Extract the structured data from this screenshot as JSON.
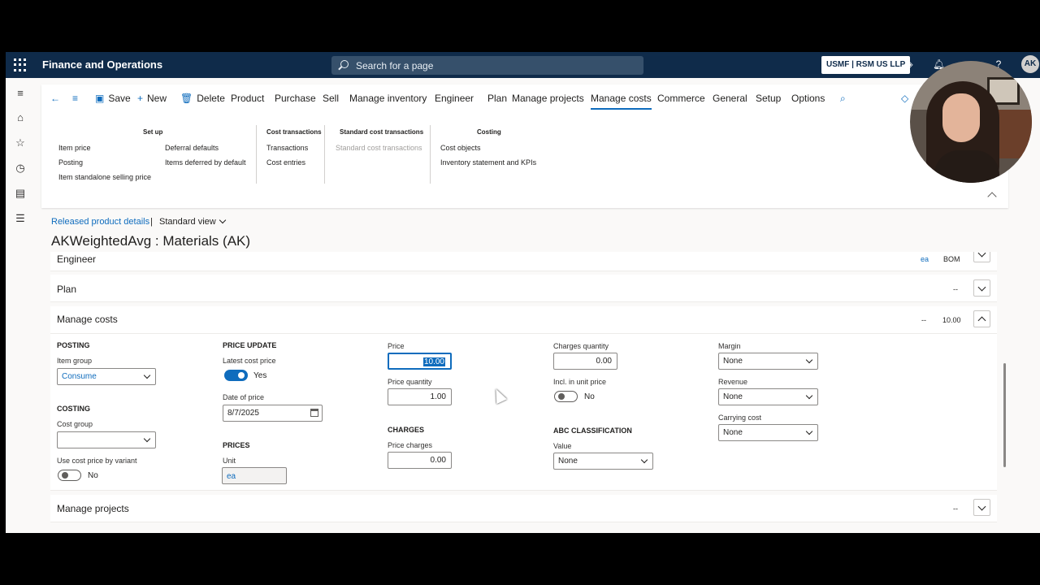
{
  "topbar": {
    "app_title": "Finance and Operations",
    "search_placeholder": "Search for a page",
    "company": "USMF | RSM US LLP",
    "avatar": "AK"
  },
  "rail": {
    "icons": [
      "hamburger-icon",
      "home-icon",
      "star-icon",
      "clock-icon",
      "workspace-icon",
      "list-icon"
    ]
  },
  "action_pane": {
    "commands": {
      "save": "Save",
      "new": "New",
      "delete": "Delete",
      "product": "Product",
      "purchase": "Purchase",
      "sell": "Sell",
      "manage_inventory": "Manage inventory",
      "engineer": "Engineer",
      "plan": "Plan",
      "manage_projects": "Manage projects",
      "manage_costs": "Manage costs",
      "commerce": "Commerce",
      "general": "General",
      "setup": "Setup",
      "options": "Options"
    },
    "groups": {
      "setup": {
        "title": "Set up",
        "items": [
          "Item price",
          "Posting",
          "Item standalone selling price",
          "Deferral defaults",
          "Items deferred by default"
        ]
      },
      "cost_transactions": {
        "title": "Cost transactions",
        "items": [
          "Transactions",
          "Cost entries"
        ]
      },
      "standard_cost_transactions": {
        "title": "Standard cost transactions",
        "items": [
          "Standard cost transactions"
        ]
      },
      "costing": {
        "title": "Costing",
        "items": [
          "Cost objects",
          "Inventory statement and KPIs"
        ]
      }
    }
  },
  "breadcrumb": {
    "link": "Released product details",
    "separator": "|",
    "view": "Standard view"
  },
  "page_title": "AKWeightedAvg : Materials (AK)",
  "fasttabs": {
    "engineer": {
      "title": "Engineer",
      "summary1": "ea",
      "summary2": "BOM"
    },
    "plan": {
      "title": "Plan",
      "summary1": "--"
    },
    "manage_costs": {
      "title": "Manage costs",
      "summary1": "--",
      "summary2": "10.00"
    },
    "manage_projects": {
      "title": "Manage projects",
      "summary1": "--"
    }
  },
  "manage_costs": {
    "posting": {
      "heading": "POSTING",
      "item_group_label": "Item group",
      "item_group_value": "Consume"
    },
    "costing": {
      "heading": "COSTING",
      "cost_group_label": "Cost group",
      "cost_group_value": "",
      "use_cost_price_label": "Use cost price by variant",
      "use_cost_price_value": "No"
    },
    "price_update": {
      "heading": "PRICE UPDATE",
      "latest_cost_label": "Latest cost price",
      "latest_cost_value": "Yes",
      "date_label": "Date of price",
      "date_value": "8/7/2025"
    },
    "prices": {
      "heading": "PRICES",
      "unit_label": "Unit",
      "unit_value": "ea"
    },
    "price": {
      "price_label": "Price",
      "price_value": "10.00",
      "qty_label": "Price quantity",
      "qty_value": "1.00"
    },
    "charges": {
      "heading": "CHARGES",
      "price_charges_label": "Price charges",
      "price_charges_value": "0.00",
      "charges_qty_label": "Charges quantity",
      "charges_qty_value": "0.00",
      "incl_label": "Incl. in unit price",
      "incl_value": "No"
    },
    "abc": {
      "heading": "ABC CLASSIFICATION",
      "value_label": "Value",
      "value_value": "None"
    },
    "margin": {
      "margin_label": "Margin",
      "margin_value": "None",
      "revenue_label": "Revenue",
      "revenue_value": "None",
      "carrying_label": "Carrying cost",
      "carrying_value": "None"
    }
  },
  "colors": {
    "topbar": "#0f2b4a",
    "accent": "#0f6cbd"
  }
}
